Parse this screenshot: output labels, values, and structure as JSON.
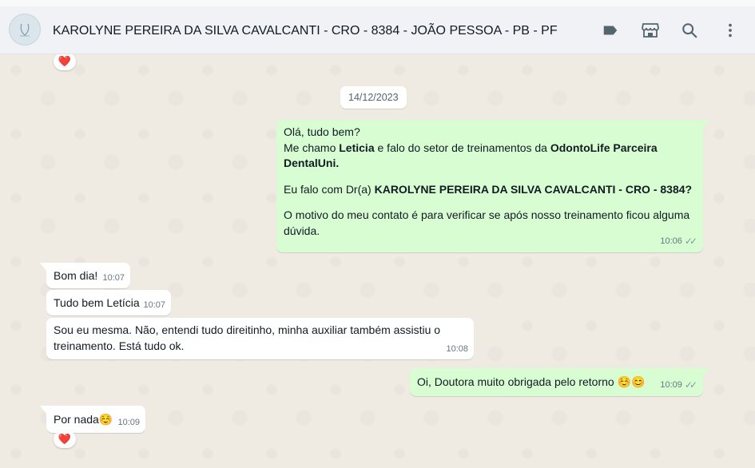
{
  "header": {
    "contact_name": "KAROLYNE PEREIRA DA SILVA CAVALCANTI - CRO - 8384 - JOÃO PESSOA - PB - PF",
    "icons": [
      "label-icon",
      "catalog-icon",
      "search-icon",
      "menu-icon"
    ]
  },
  "chat": {
    "date_divider": "14/12/2023",
    "reaction_emoji": "❤️",
    "messages": [
      {
        "direction": "outgoing",
        "line1": "Olá, tudo bem?",
        "line2_a": "Me chamo ",
        "line2_b": "Leticia",
        "line2_c": " e falo do setor de treinamentos  da ",
        "line2_d": "OdontoLife Parceira",
        "line3": "DentalUni.",
        "line4_a": " Eu falo com Dr(a) ",
        "line4_b": "KAROLYNE PEREIRA DA SILVA CAVALCANTI - CRO - 8384?",
        "line5": "O motivo do meu contato é para verificar se após nosso treinamento ficou alguma",
        "line6": "dúvida.",
        "time": "10:06"
      },
      {
        "direction": "incoming",
        "text": "Bom dia!",
        "time": "10:07"
      },
      {
        "direction": "incoming",
        "text": "Tudo bem Letícia",
        "time": "10:07"
      },
      {
        "direction": "incoming",
        "line1": "Sou eu mesma. Não, entendi tudo direitinho, minha auxiliar também assistiu o",
        "line2": "treinamento. Está tudo ok.",
        "time": "10:08"
      },
      {
        "direction": "outgoing",
        "text": "Oi, Doutora muito obrigada pelo retorno ☺️😊",
        "time": "10:09"
      },
      {
        "direction": "incoming",
        "text": "Por nada☺️",
        "time": "10:09"
      }
    ]
  }
}
